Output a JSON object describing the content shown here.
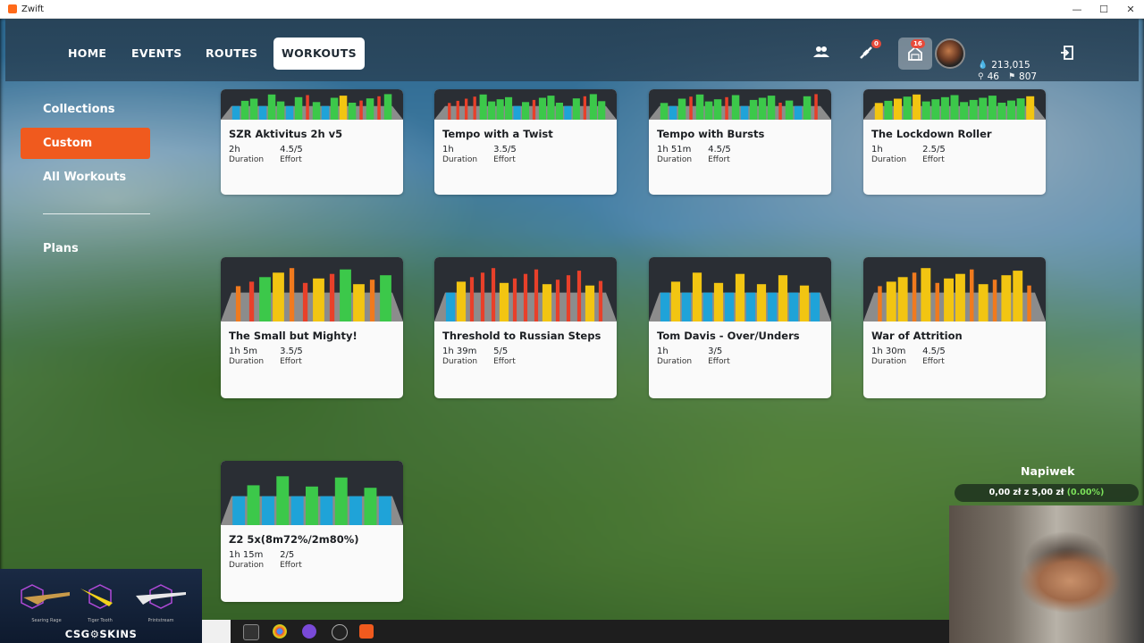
{
  "window": {
    "title": "Zwift",
    "controls": [
      "—",
      "☐",
      "✕"
    ]
  },
  "nav": {
    "tabs": [
      {
        "label": "HOME"
      },
      {
        "label": "EVENTS"
      },
      {
        "label": "ROUTES"
      },
      {
        "label": "WORKOUTS",
        "active": true
      }
    ],
    "badges": {
      "notifications": "0",
      "home": "16"
    },
    "stats": {
      "drops": "213,015",
      "level_a": "46",
      "level_b": "807"
    }
  },
  "sidebar": {
    "items": [
      {
        "label": "Collections"
      },
      {
        "label": "Custom",
        "active": true
      },
      {
        "label": "All Workouts"
      },
      {
        "label": "Plans"
      }
    ]
  },
  "workouts": {
    "duration_label": "Duration",
    "effort_label": "Effort",
    "cards": [
      {
        "title": "SZR Aktivitus 2h v5",
        "duration": "2h",
        "effort": "4.5/5"
      },
      {
        "title": "Tempo with a Twist",
        "duration": "1h",
        "effort": "3.5/5"
      },
      {
        "title": "Tempo with Bursts",
        "duration": "1h 51m",
        "effort": "4.5/5"
      },
      {
        "title": "The Lockdown Roller",
        "duration": "1h",
        "effort": "2.5/5"
      },
      {
        "title": "The Small but Mighty!",
        "duration": "1h 5m",
        "effort": "3.5/5"
      },
      {
        "title": "Threshold to Russian Steps",
        "duration": "1h 39m",
        "effort": "5/5"
      },
      {
        "title": "Tom Davis - Over/Unders",
        "duration": "1h",
        "effort": "3/5"
      },
      {
        "title": "War of Attrition",
        "duration": "1h 30m",
        "effort": "4.5/5"
      },
      {
        "title": "Z2 5x(8m72%/2m80%)",
        "duration": "1h 15m",
        "effort": "2/5"
      }
    ]
  },
  "tip_widget": {
    "title": "Napiwek",
    "amount": "0,00 zł z 5,00 zł",
    "percent": "(0.00%)"
  },
  "overlay": {
    "brand": "CSG⚙SKINS",
    "skins": [
      "Searing Rage",
      "Tiger Tooth",
      "Printstream"
    ]
  },
  "colors": {
    "accent": "#f05a1e",
    "zone_blue": "#1fa3d8",
    "zone_green": "#3cc84a",
    "zone_yellow": "#f2c512",
    "zone_orange": "#f07a1e",
    "zone_red": "#e8402a",
    "zone_grey": "#8c8c8c"
  }
}
